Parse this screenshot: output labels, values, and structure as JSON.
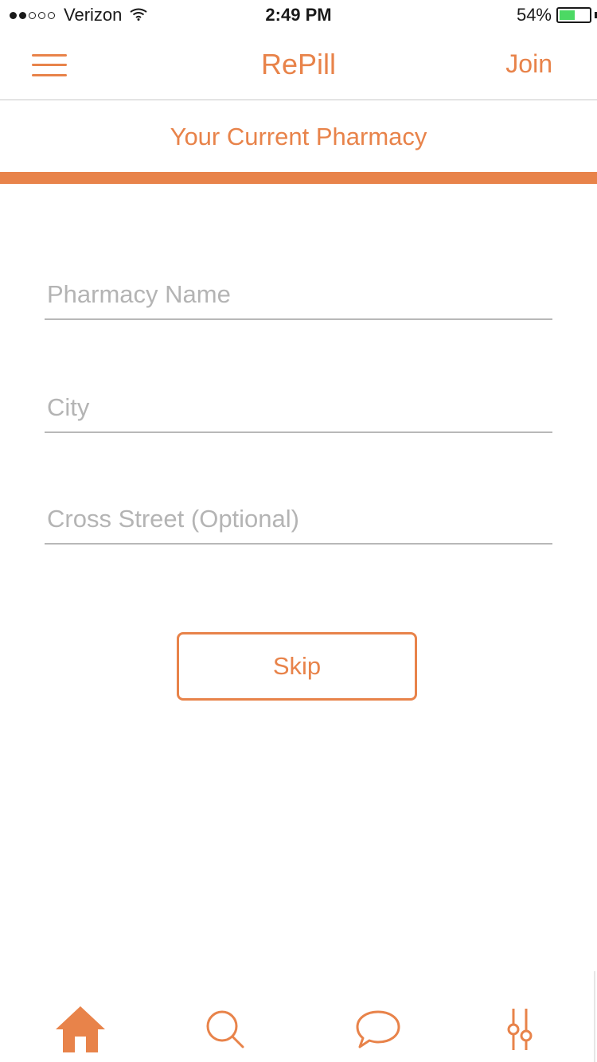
{
  "status_bar": {
    "carrier": "Verizon",
    "time": "2:49 PM",
    "battery_percent": "54%",
    "battery_level": 0.54,
    "signal_bars_filled": 2,
    "signal_bars_total": 5
  },
  "nav": {
    "menu_icon": "hamburger-menu-icon",
    "title": "RePill",
    "join_label": "Join"
  },
  "section": {
    "title": "Your Current Pharmacy"
  },
  "form": {
    "pharmacy_name": {
      "placeholder": "Pharmacy Name",
      "value": ""
    },
    "city": {
      "placeholder": "City",
      "value": ""
    },
    "cross_street": {
      "placeholder": "Cross Street (Optional)",
      "value": ""
    }
  },
  "actions": {
    "skip_label": "Skip"
  },
  "tab_bar": {
    "tabs": [
      {
        "icon": "home-icon",
        "active": true
      },
      {
        "icon": "search-icon",
        "active": false
      },
      {
        "icon": "chat-icon",
        "active": false
      },
      {
        "icon": "sliders-icon",
        "active": false
      }
    ]
  },
  "colors": {
    "accent": "#e8834a",
    "placeholder": "#b4b4b4",
    "divider": "#b8b8b8",
    "battery_green": "#4cd964"
  }
}
